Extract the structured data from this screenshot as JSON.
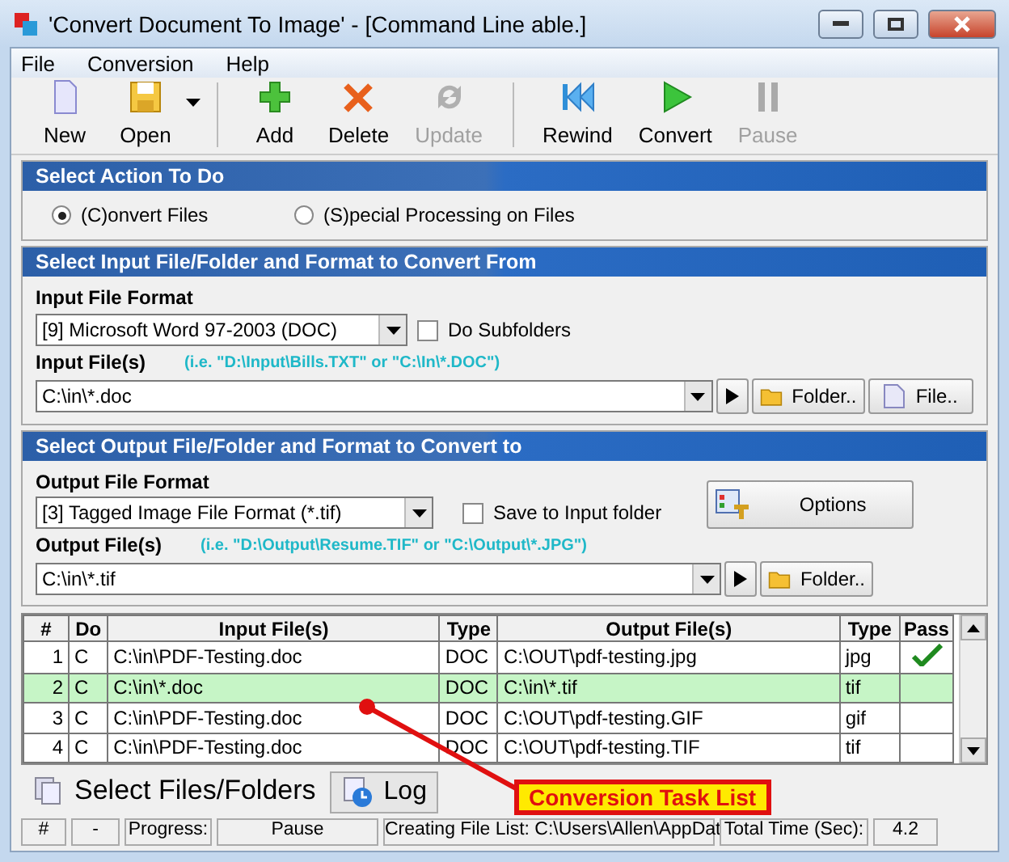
{
  "window": {
    "title": "'Convert Document To Image' - [Command Line able.]"
  },
  "menu": [
    "File",
    "Conversion",
    "Help"
  ],
  "toolbar": [
    {
      "kind": "new",
      "label": "New",
      "disabled": false
    },
    {
      "kind": "open",
      "label": "Open",
      "disabled": false
    },
    {
      "kind": "add",
      "label": "Add",
      "disabled": false
    },
    {
      "kind": "delete",
      "label": "Delete",
      "disabled": false
    },
    {
      "kind": "update",
      "label": "Update",
      "disabled": true
    },
    {
      "kind": "rewind",
      "label": "Rewind",
      "disabled": false
    },
    {
      "kind": "convert",
      "label": "Convert",
      "disabled": false
    },
    {
      "kind": "pause",
      "label": "Pause",
      "disabled": true
    }
  ],
  "action_section": {
    "title": "Select Action To Do",
    "options": [
      {
        "label": "(C)onvert Files",
        "selected": true
      },
      {
        "label": "(S)pecial Processing on Files",
        "selected": false
      }
    ]
  },
  "input_section": {
    "title": "Select Input File/Folder and Format to Convert From",
    "format_label": "Input File Format",
    "format_value": "[9] Microsoft Word 97-2003 (DOC)",
    "subfolders": {
      "label": "Do Subfolders",
      "checked": false
    },
    "files_label": "Input File(s)",
    "files_hint": "(i.e. \"D:\\Input\\Bills.TXT\"  or \"C:\\In\\*.DOC\")",
    "files_value": "C:\\in\\*.doc",
    "buttons": [
      "Folder..",
      "File.."
    ]
  },
  "output_section": {
    "title": "Select Output File/Folder and Format to Convert to",
    "format_label": "Output File Format",
    "format_value": "[3] Tagged Image File Format (*.tif)",
    "save_to_input": {
      "label": "Save to Input folder",
      "checked": false
    },
    "options_button": "Options",
    "files_label": "Output File(s)",
    "files_hint": "(i.e. \"D:\\Output\\Resume.TIF\" or \"C:\\Output\\*.JPG\")",
    "files_value": "C:\\in\\*.tif",
    "buttons": [
      "Folder.."
    ]
  },
  "table": {
    "columns": [
      "#",
      "Do",
      "Input File(s)",
      "Type",
      "Output File(s)",
      "Type",
      "Pass"
    ],
    "rows": [
      {
        "cells": [
          "1",
          "C",
          "C:\\in\\PDF-Testing.doc",
          "DOC",
          "C:\\OUT\\pdf-testing.jpg",
          "jpg"
        ],
        "passed": true,
        "selected": false
      },
      {
        "cells": [
          "2",
          "C",
          "C:\\in\\*.doc",
          "DOC",
          "C:\\in\\*.tif",
          "tif"
        ],
        "passed": false,
        "selected": true
      },
      {
        "cells": [
          "3",
          "C",
          "C:\\in\\PDF-Testing.doc",
          "DOC",
          "C:\\OUT\\pdf-testing.GIF",
          "gif"
        ],
        "passed": false,
        "selected": false
      },
      {
        "cells": [
          "4",
          "C",
          "C:\\in\\PDF-Testing.doc",
          "DOC",
          "C:\\OUT\\pdf-testing.TIF",
          "tif"
        ],
        "passed": false,
        "selected": false
      }
    ]
  },
  "tabs": [
    {
      "label": "Select Files/Folders",
      "selected": true
    },
    {
      "label": "Log",
      "selected": false
    }
  ],
  "annotation": "Conversion Task List",
  "status_bar": [
    "#",
    "-",
    "Progress:",
    "Pause",
    "Creating File List: C:\\Users\\Allen\\AppDat",
    "Total Time (Sec):",
    "4.2"
  ]
}
